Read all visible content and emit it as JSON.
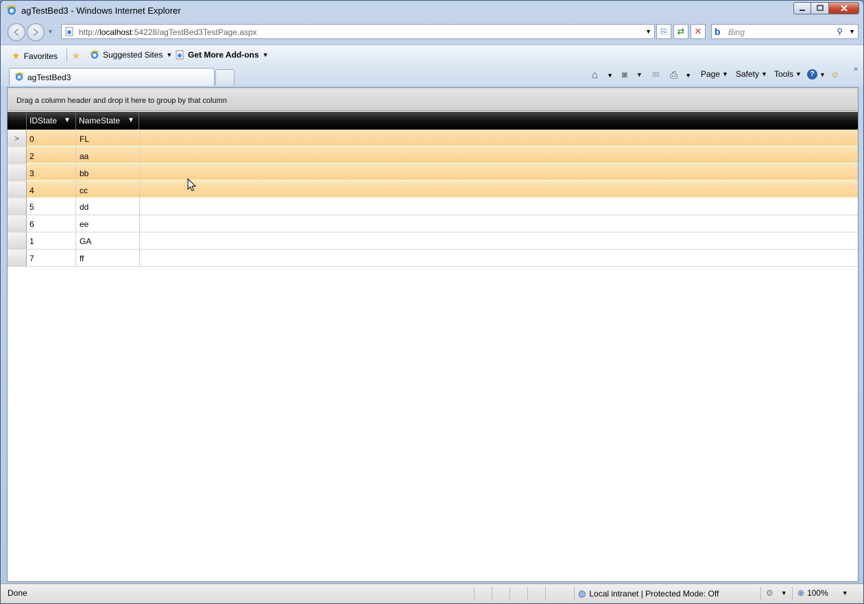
{
  "window": {
    "title": "agTestBed3 - Windows Internet Explorer"
  },
  "address": {
    "prefix": "http://",
    "host": "localhost",
    "rest": ":54228/agTestBed3TestPage.aspx"
  },
  "search": {
    "placeholder": "Bing"
  },
  "favorites_bar": {
    "favorites_label": "Favorites",
    "suggested_label": "Suggested Sites",
    "addons_label": "Get More Add-ons"
  },
  "tab": {
    "label": "agTestBed3"
  },
  "commands": {
    "page": "Page",
    "safety": "Safety",
    "tools": "Tools"
  },
  "grid": {
    "group_hint": "Drag a column header and drop it here to group by that column",
    "columns": [
      "IDState",
      "NameState"
    ],
    "rows": [
      {
        "id": "0",
        "name": "FL",
        "selected": true,
        "current": true
      },
      {
        "id": "2",
        "name": "aa",
        "selected": true
      },
      {
        "id": "3",
        "name": "bb",
        "selected": true
      },
      {
        "id": "4",
        "name": "cc",
        "selected": true
      },
      {
        "id": "5",
        "name": "dd",
        "selected": false
      },
      {
        "id": "6",
        "name": "ee",
        "selected": false
      },
      {
        "id": "1",
        "name": "GA",
        "selected": false
      },
      {
        "id": "7",
        "name": "ff",
        "selected": false
      }
    ]
  },
  "status": {
    "left": "Done",
    "zone": "Local intranet | Protected Mode: Off",
    "zoom": "100%"
  },
  "colors": {
    "selected_row": "#fbd590",
    "header": "#000000",
    "accent": "#1a5fb4"
  }
}
